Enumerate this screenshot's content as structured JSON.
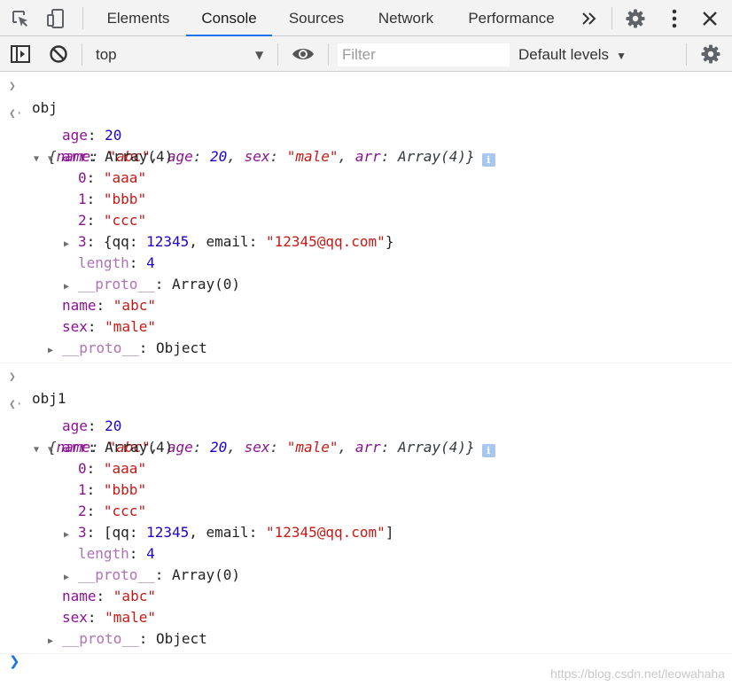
{
  "tabs": [
    {
      "label": "Elements"
    },
    {
      "label": "Console",
      "active": true
    },
    {
      "label": "Sources"
    },
    {
      "label": "Network"
    },
    {
      "label": "Performance"
    }
  ],
  "toolbar": {
    "context": "top",
    "filter_placeholder": "Filter",
    "levels": "Default levels"
  },
  "entries": [
    {
      "input": "obj",
      "preview": [
        "{",
        "name",
        ": ",
        "\"abc\"",
        ", ",
        "age",
        ": ",
        "20",
        ", ",
        "sex",
        ": ",
        "\"male\"",
        ", ",
        "arr",
        ": ",
        "Array(4)",
        "}"
      ],
      "age": "20",
      "arr_label": "Array(4)",
      "items": [
        "\"aaa\"",
        "\"bbb\"",
        "\"ccc\""
      ],
      "item3_open": "{",
      "item3_close": "}",
      "qq": "12345",
      "email": "\"12345@qq.com\"",
      "length": "4",
      "arr_proto": "Array(0)",
      "name": "\"abc\"",
      "sex": "\"male\"",
      "proto": "Object"
    },
    {
      "input": "obj1",
      "preview": [
        "{",
        "name",
        ": ",
        "\"abc\"",
        ", ",
        "age",
        ": ",
        "20",
        ", ",
        "sex",
        ": ",
        "\"male\"",
        ", ",
        "arr",
        ": ",
        "Array(4)",
        "}"
      ],
      "age": "20",
      "arr_label": "Array(4)",
      "items": [
        "\"aaa\"",
        "\"bbb\"",
        "\"ccc\""
      ],
      "item3_open": "[",
      "item3_close": "]",
      "qq": "12345",
      "email": "\"12345@qq.com\"",
      "length": "4",
      "arr_proto": "Array(0)",
      "name": "\"abc\"",
      "sex": "\"male\"",
      "proto": "Object"
    }
  ],
  "labels": {
    "age": "age",
    "arr": "arr",
    "qq": "qq",
    "email": "email",
    "length": "length",
    "proto": "__proto__",
    "name": "name",
    "sex": "sex",
    "idx0": "0",
    "idx1": "1",
    "idx2": "2",
    "idx3": "3"
  },
  "watermark": "https://blog.csdn.net/leowahaha",
  "icons": [
    "inspect-element-icon",
    "device-toolbar-icon",
    "more-tabs-icon",
    "settings-icon",
    "kebab-menu-icon",
    "close-icon",
    "sidebar-toggle-icon",
    "clear-console-icon",
    "eye-icon",
    "console-settings-icon"
  ],
  "colors": {
    "accent": "#1a73e8",
    "key": "#881391",
    "string": "#c41a16",
    "number": "#1c00cf"
  }
}
